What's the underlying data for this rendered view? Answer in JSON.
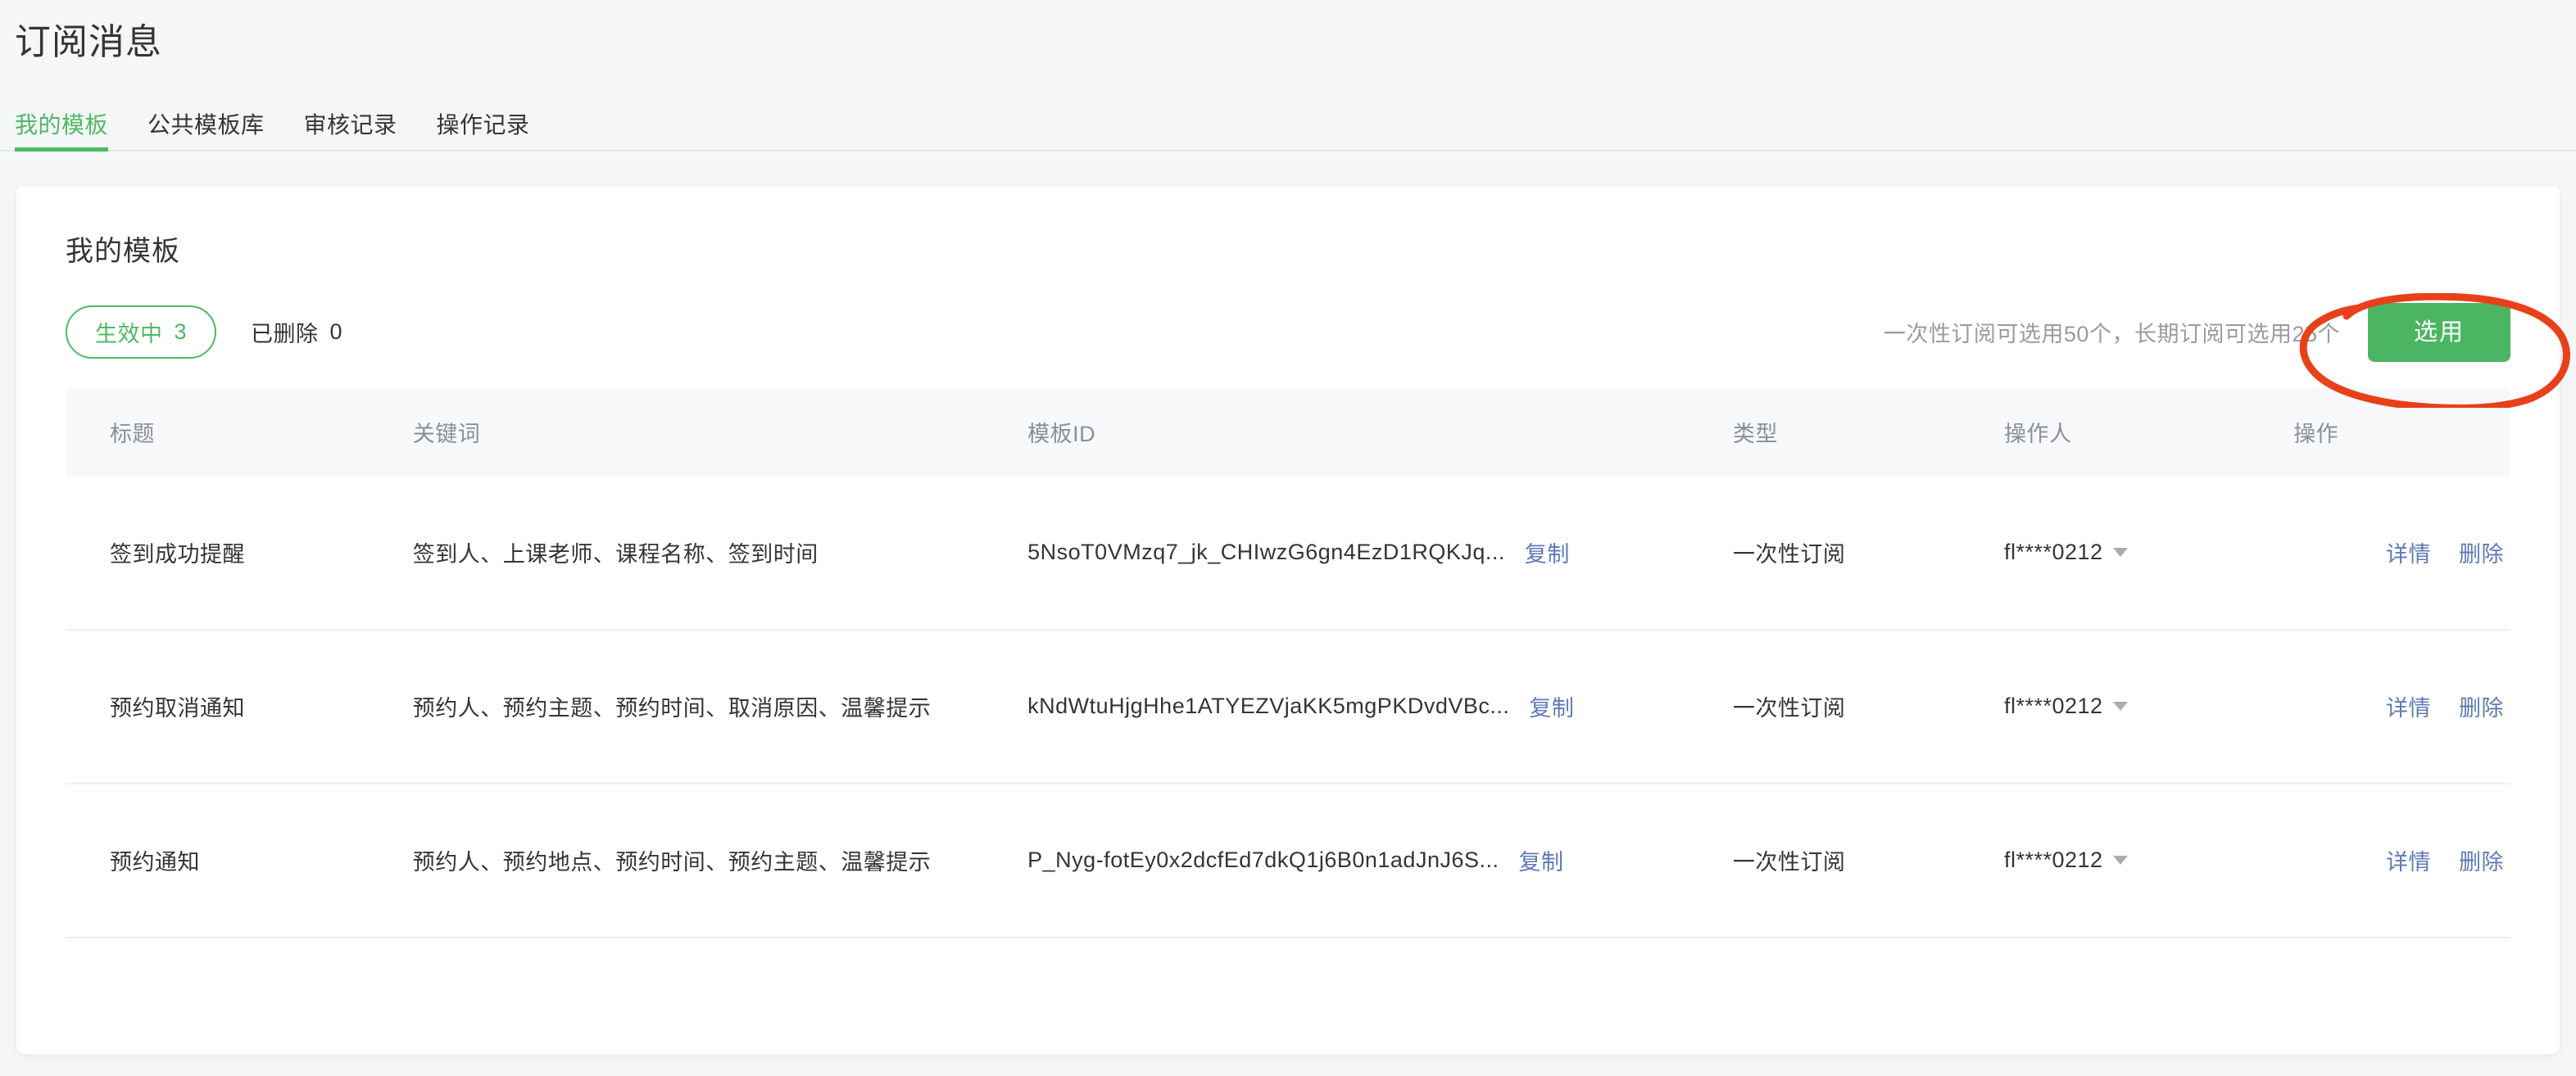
{
  "page": {
    "title": "订阅消息",
    "background_color": "#f5f6f8"
  },
  "tabs": [
    {
      "label": "我的模板",
      "active": true
    },
    {
      "label": "公共模板库",
      "active": false
    },
    {
      "label": "审核记录",
      "active": false
    },
    {
      "label": "操作记录",
      "active": false
    }
  ],
  "card": {
    "title": "我的模板"
  },
  "filters": [
    {
      "label": "生效中",
      "count": "3",
      "selected": true
    },
    {
      "label": "已删除",
      "count": "0",
      "selected": false
    }
  ],
  "toolbar": {
    "quota_hint": "一次性订阅可选用50个，长期订阅可选用25个",
    "primary_button": "选用"
  },
  "table": {
    "columns": [
      "标题",
      "关键词",
      "模板ID",
      "类型",
      "操作人",
      "操作"
    ],
    "copy_label": "复制",
    "row_actions": [
      "详情",
      "删除"
    ],
    "rows": [
      {
        "title": "签到成功提醒",
        "keywords": "签到人、上课老师、课程名称、签到时间",
        "template_id": "5NsoT0VMzq7_jk_CHIwzG6gn4EzD1RQKJq...",
        "type": "一次性订阅",
        "operator": "fl****0212"
      },
      {
        "title": "预约取消通知",
        "keywords": "预约人、预约主题、预约时间、取消原因、温馨提示",
        "template_id": "kNdWtuHjgHhe1ATYEZVjaKK5mgPKDvdVBc...",
        "type": "一次性订阅",
        "operator": "fl****0212"
      },
      {
        "title": "预约通知",
        "keywords": "预约人、预约地点、预约时间、预约主题、温馨提示",
        "template_id": "P_Nyg-fotEy0x2dcfEd7dkQ1j6B0n1adJnJ6S...",
        "type": "一次性订阅",
        "operator": "fl****0212"
      }
    ]
  },
  "colors": {
    "accent_green": "#4fb963",
    "button_green": "#4cb563",
    "link_blue": "#5f7ab3",
    "annotation_red": "#e8401a",
    "muted_text": "#9b9b9b",
    "header_text": "#8b8f96"
  },
  "icons": {
    "caret": "caret-down-icon",
    "annotation": "highlight-circle-annotation"
  }
}
